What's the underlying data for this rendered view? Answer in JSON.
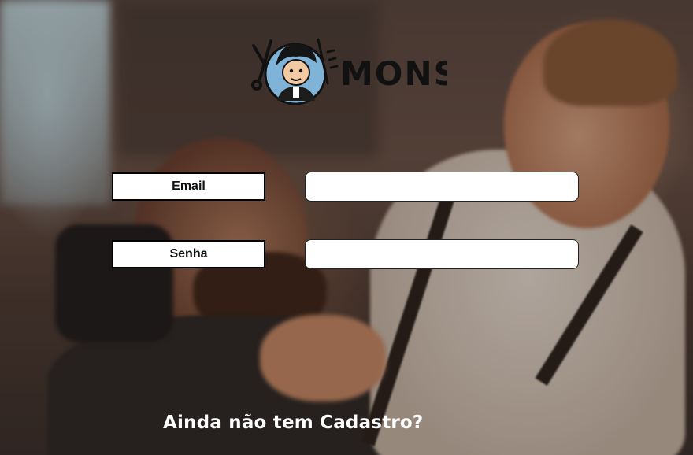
{
  "brand": {
    "logo_text": "MONS",
    "logo_icon": "barber-mascot-icon"
  },
  "form": {
    "email_label": "Email",
    "email_value": "",
    "password_label": "Senha",
    "password_value": ""
  },
  "signup_link": "Ainda não tem Cadastro?",
  "background": {
    "subject": "barber-trimming-beard-photo",
    "dominant_color": "#5a4840"
  }
}
